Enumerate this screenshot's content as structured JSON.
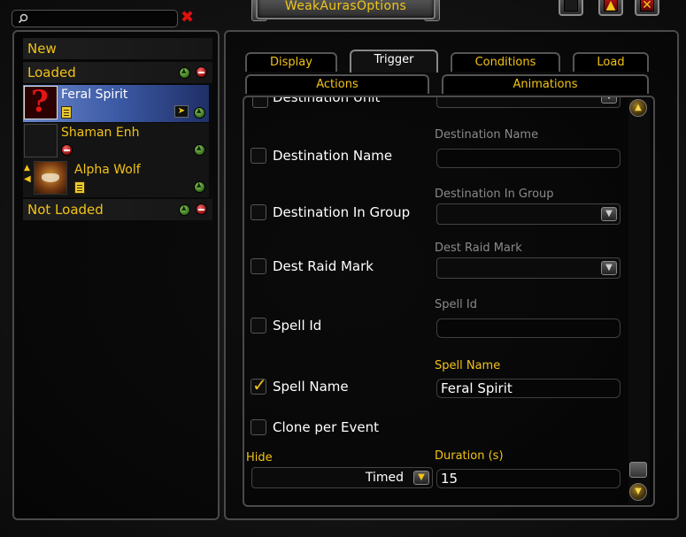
{
  "window": {
    "title": "WeakAurasOptions",
    "buttons": [
      {
        "name": "move-to-top",
        "glyph": "▲"
      },
      {
        "name": "close",
        "glyph": "✕"
      }
    ]
  },
  "search": {
    "value": "",
    "placeholder": ""
  },
  "sidebar": {
    "new_label": "New",
    "loaded_label": "Loaded",
    "not_loaded_label": "Not Loaded",
    "auras": [
      {
        "name": "Feral Spirit",
        "selected": true,
        "icon": "question-mark-icon"
      },
      {
        "name": "Shaman Enh",
        "selected": false,
        "icon": "empty-icon"
      },
      {
        "name": "Alpha Wolf",
        "selected": false,
        "icon": "wolf-icon"
      }
    ]
  },
  "tabs": {
    "row1": [
      "Display",
      "Trigger",
      "Conditions",
      "Load"
    ],
    "row2": [
      "Actions",
      "Animations"
    ],
    "active": "Trigger"
  },
  "trigger": {
    "cut_label": "Destination Unit",
    "options": [
      {
        "label": "Destination Name",
        "checked": false,
        "field_label": "Destination Name",
        "field_type": "text",
        "field_value": ""
      },
      {
        "label": "Destination In Group",
        "checked": false,
        "field_label": "Destination In Group",
        "field_type": "dropdown",
        "field_value": ""
      },
      {
        "label": "Dest Raid Mark",
        "checked": false,
        "field_label": "Dest Raid Mark",
        "field_type": "dropdown",
        "field_value": ""
      },
      {
        "label": "Spell Id",
        "checked": false,
        "field_label": "Spell Id",
        "field_type": "text",
        "field_value": ""
      },
      {
        "label": "Spell Name",
        "checked": true,
        "field_label": "Spell Name",
        "field_type": "text",
        "field_value": "Feral Spirit"
      },
      {
        "label": "Clone per Event",
        "checked": false
      }
    ],
    "hide": {
      "label": "Hide",
      "value": "Timed"
    },
    "duration": {
      "label": "Duration (s)",
      "value": "15"
    }
  },
  "colors": {
    "accent_gold": "#f2c318",
    "selected_row": "#3c5aa6",
    "close_red": "#b81414"
  }
}
